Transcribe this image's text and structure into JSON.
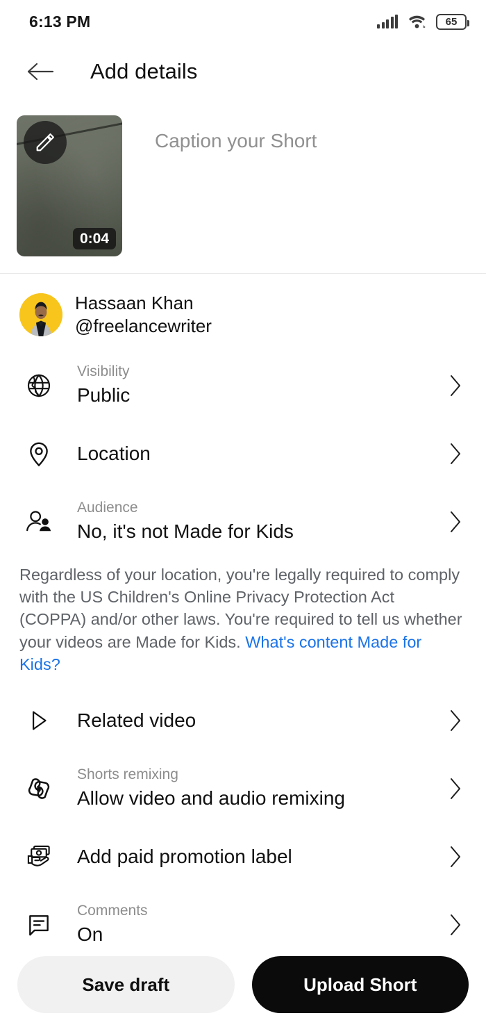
{
  "status_bar": {
    "time": "6:13 PM",
    "battery_level": "65",
    "signal_icon": "signal-bars-icon",
    "wifi_icon": "wifi-icon",
    "battery_icon": "battery-icon"
  },
  "header": {
    "back_icon": "back-arrow-icon",
    "title": "Add details"
  },
  "caption": {
    "placeholder": "Caption your Short",
    "edit_icon": "pencil-edit-icon",
    "duration": "0:04"
  },
  "channel": {
    "name": "Hassaan Khan",
    "handle": "@freelancewriter",
    "avatar_icon": "avatar"
  },
  "rows": [
    {
      "icon": "globe-icon",
      "sub": "Visibility",
      "title": "Public",
      "chevron": "chevron-right-icon"
    },
    {
      "icon": "location-pin-icon",
      "sub": "",
      "title": "Location",
      "chevron": "chevron-right-icon"
    },
    {
      "icon": "audience-people-icon",
      "sub": "Audience",
      "title": "No, it's not Made for Kids",
      "chevron": "chevron-right-icon"
    },
    {
      "icon": "play-triangle-icon",
      "sub": "",
      "title": "Related video",
      "chevron": "chevron-right-icon"
    },
    {
      "icon": "shorts-remix-icon",
      "sub": "Shorts remixing",
      "title": "Allow video and audio remixing",
      "chevron": "chevron-right-icon"
    },
    {
      "icon": "paid-promotion-icon",
      "sub": "",
      "title": "Add paid promotion label",
      "chevron": "chevron-right-icon"
    },
    {
      "icon": "comment-bubble-icon",
      "sub": "Comments",
      "title": "On",
      "chevron": "chevron-right-icon"
    }
  ],
  "coppa": {
    "text": "Regardless of your location, you're legally required to comply with the US Children's Online Privacy Protection Act (COPPA) and/or other laws. You're required to tell us whether your videos are Made for Kids.",
    "link_text": "What's content Made for Kids?",
    "link_color": "#1a73e8"
  },
  "footer": {
    "save_draft_label": "Save draft",
    "upload_label": "Upload Short"
  }
}
